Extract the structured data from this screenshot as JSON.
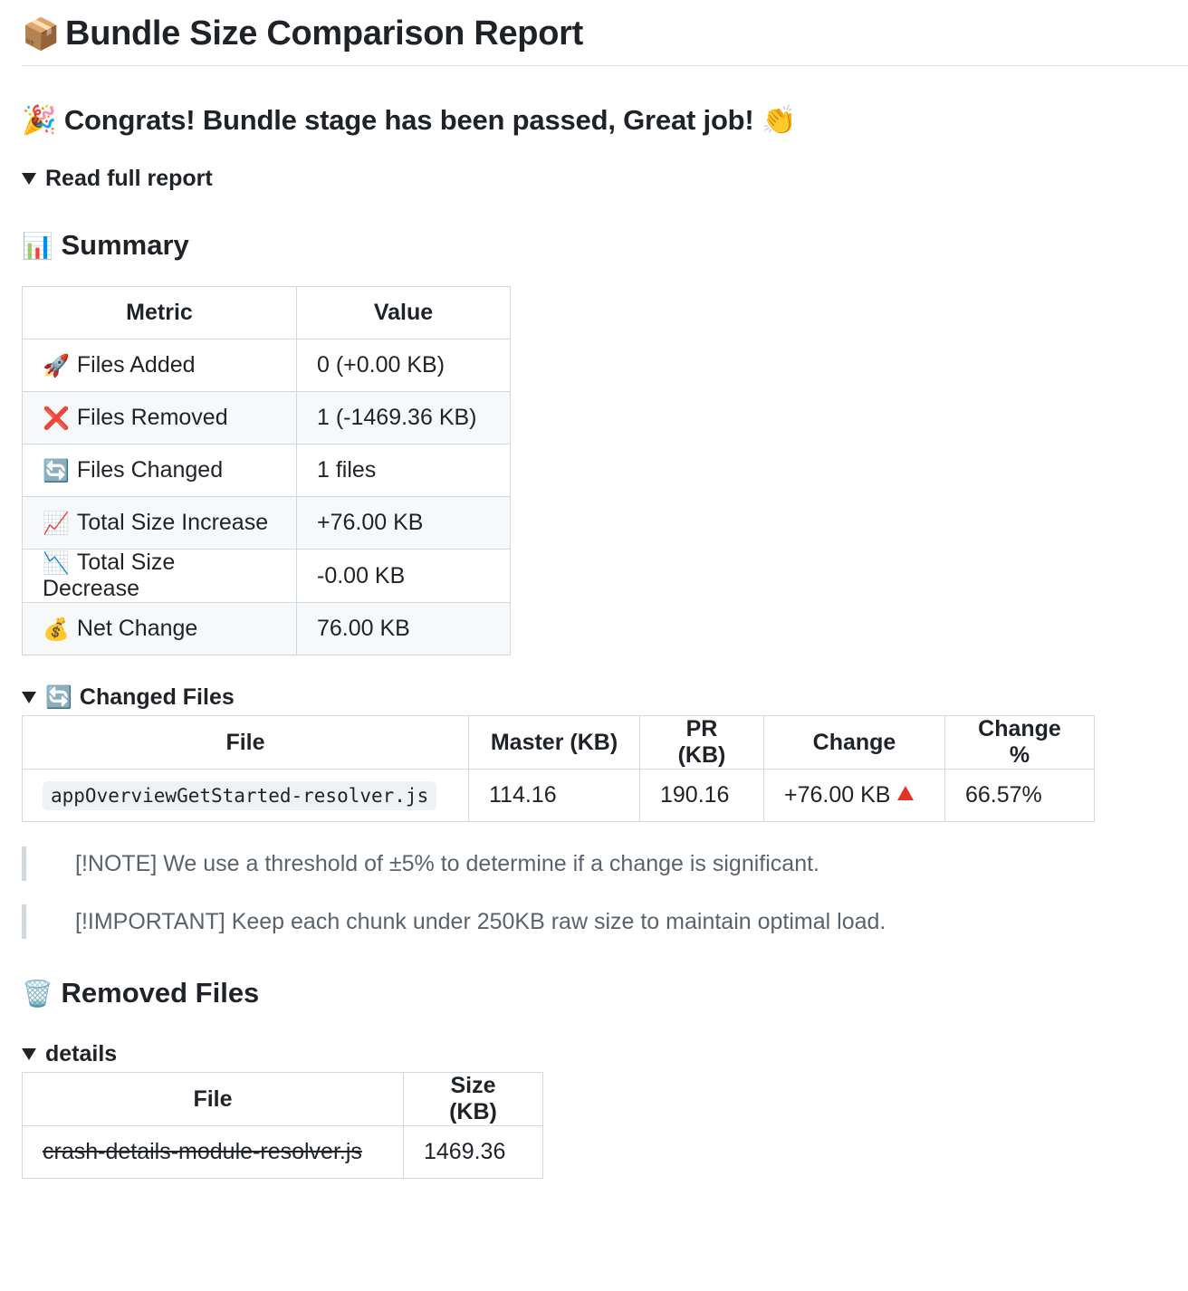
{
  "header": {
    "title": "Bundle Size Comparison Report",
    "title_icon": "package-icon",
    "title_emoji": "📦"
  },
  "congrats": {
    "text": "Congrats! Bundle stage has been passed, Great job!",
    "left_emoji": "🎉",
    "right_emoji": "👏"
  },
  "full_report": {
    "summary_label": "Read full report"
  },
  "summary": {
    "title": "Summary",
    "emoji": "📊",
    "columns": [
      "Metric",
      "Value"
    ],
    "rows": [
      {
        "emoji": "🚀",
        "metric": "Files Added",
        "value": "0 (+0.00 KB)"
      },
      {
        "emoji": "❌",
        "metric": "Files Removed",
        "value": "1 (-1469.36 KB)"
      },
      {
        "emoji": "🔄",
        "metric": "Files Changed",
        "value": "1 files"
      },
      {
        "emoji": "📈",
        "metric": "Total Size Increase",
        "value": "+76.00 KB"
      },
      {
        "emoji": "📉",
        "metric": "Total Size Decrease",
        "value": "-0.00 KB"
      },
      {
        "emoji": "💰",
        "metric": "Net Change",
        "value": "76.00 KB"
      }
    ]
  },
  "changed_files": {
    "summary_label": "Changed Files",
    "emoji": "🔄",
    "columns": [
      "File",
      "Master (KB)",
      "PR (KB)",
      "Change",
      "Change %"
    ],
    "rows": [
      {
        "file": "appOverviewGetStarted-resolver.js",
        "master": "114.16",
        "pr": "190.16",
        "change": "+76.00 KB",
        "change_pct": "66.57%"
      }
    ]
  },
  "notes": [
    "[!NOTE] We use a threshold of ±5% to determine if a change is significant.",
    "[!IMPORTANT] Keep each chunk under 250KB raw size to maintain optimal load."
  ],
  "removed_files": {
    "title": "Removed Files",
    "emoji": "🗑️",
    "details_label": "details",
    "columns": [
      "File",
      "Size (KB)"
    ],
    "rows": [
      {
        "file": "crash-details-module-resolver.js",
        "size": "1469.36"
      }
    ]
  }
}
